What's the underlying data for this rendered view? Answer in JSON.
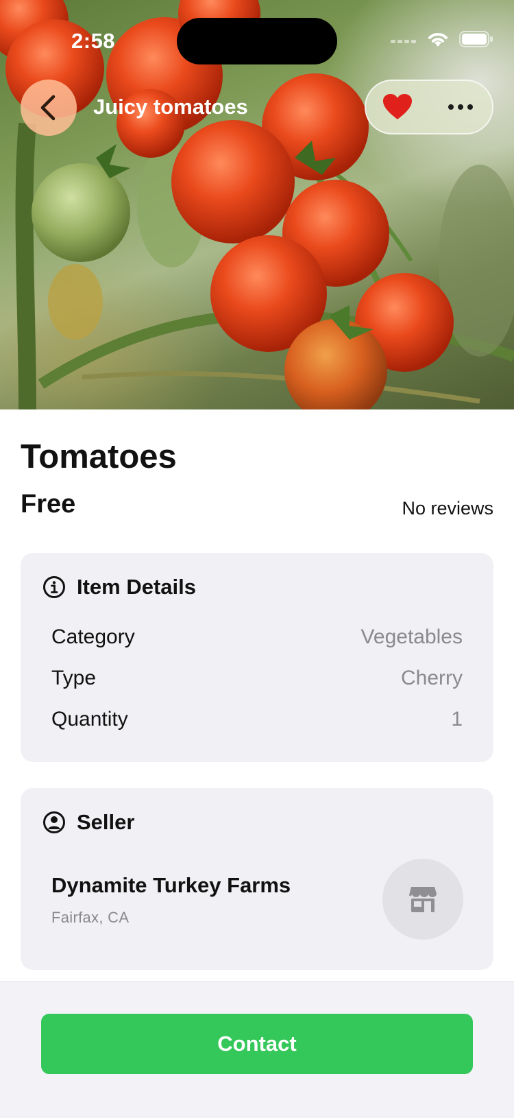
{
  "status_bar": {
    "time": "2:58"
  },
  "nav": {
    "title": "Juicy tomatoes"
  },
  "listing": {
    "title": "Tomatoes",
    "price": "Free",
    "reviews": "No reviews"
  },
  "item_details": {
    "heading": "Item Details",
    "rows": [
      {
        "label": "Category",
        "value": "Vegetables"
      },
      {
        "label": "Type",
        "value": "Cherry"
      },
      {
        "label": "Quantity",
        "value": "1"
      }
    ]
  },
  "seller": {
    "heading": "Seller",
    "name": "Dynamite Turkey Farms",
    "location": "Fairfax, CA"
  },
  "actions": {
    "contact_label": "Contact"
  },
  "colors": {
    "accent_green": "#34c759",
    "heart_red": "#e0201b",
    "card_bg": "#f1f1f5"
  },
  "icons": [
    "chevron-left-icon",
    "heart-icon",
    "more-icon",
    "info-icon",
    "person-circle-icon",
    "storefront-icon",
    "wifi-icon",
    "battery-icon"
  ]
}
